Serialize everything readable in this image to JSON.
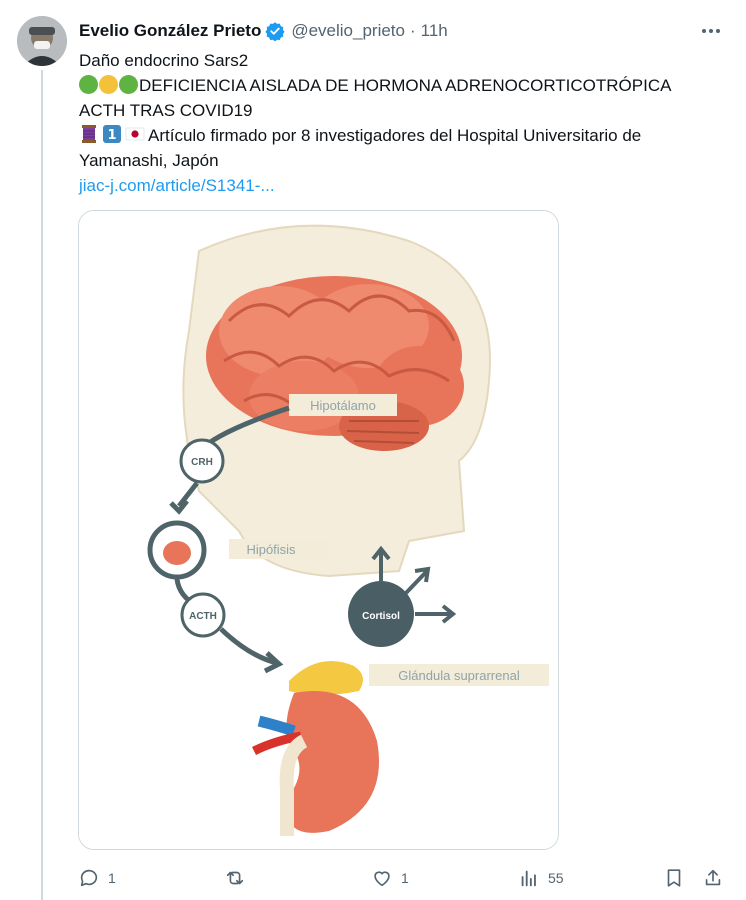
{
  "author": {
    "display_name": "Evelio González Prieto",
    "handle": "@evelio_prieto",
    "separator": "·",
    "time": "11h",
    "verified_icon": "verified-badge-icon",
    "avatar_icon": "avatar-photo"
  },
  "tweet": {
    "line1": "Daño endocrino Sars2",
    "line2_emoji": [
      "green-circle",
      "yellow-circle",
      "green-circle"
    ],
    "line2_text": "DEFICIENCIA AISLADA DE HORMONA ADRENOCORTICOTRÓPICA",
    "line3_text": "ACTH TRAS COVID19",
    "line4_emoji": [
      "thread-spool",
      "keycap-1",
      "japan-flag"
    ],
    "line4_text": "Artículo firmado por 8 investigadores del Hospital Universitario de",
    "line5_text": "Yamanashi, Japón",
    "link": "jiac-j.com/article/S1341-..."
  },
  "image": {
    "labels": {
      "hypothalamus": "Hipotálamo",
      "crh": "CRH",
      "pituitary": "Hipófisis",
      "acth": "ACTH",
      "cortisol": "Cortisol",
      "adrenal": "Glándula suprarrenal"
    }
  },
  "actions": {
    "reply_count": "1",
    "retweet_count": "",
    "like_count": "1",
    "views_count": "55"
  },
  "colors": {
    "accent": "#1d9bf0",
    "muted": "#536471",
    "brain": "#e8745a",
    "gland": "#f5c842",
    "cortisol": "#4a5f65"
  }
}
